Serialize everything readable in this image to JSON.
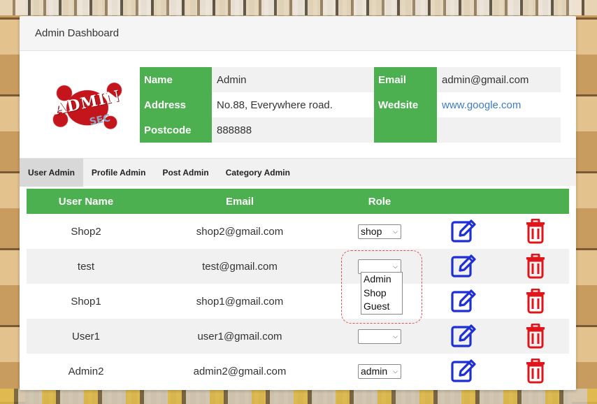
{
  "panel": {
    "title": "Admin Dashboard"
  },
  "logo": {
    "text": "ADMIN",
    "sub": "SEC"
  },
  "profile": {
    "name_label": "Name",
    "name_value": "Admin",
    "address_label": "Address",
    "address_value": "No.88, Everywhere road.",
    "postcode_label": "Postcode",
    "postcode_value": "888888",
    "email_label": "Email",
    "email_value": "admin@gmail.com",
    "website_label": "Wedsite",
    "website_value": "www.google.com"
  },
  "tabs": [
    {
      "label": "User Admin"
    },
    {
      "label": "Profile Admin"
    },
    {
      "label": "Post Admin"
    },
    {
      "label": "Category Admin"
    }
  ],
  "table": {
    "headers": {
      "user": "User Name",
      "email": "Email",
      "role": "Role"
    },
    "rows": [
      {
        "user": "Shop2",
        "email": "shop2@gmail.com",
        "role": "shop"
      },
      {
        "user": "test",
        "email": "test@gmail.com",
        "role": ""
      },
      {
        "user": "Shop1",
        "email": "shop1@gmail.com",
        "role": ""
      },
      {
        "user": "User1",
        "email": "user1@gmail.com",
        "role": ""
      },
      {
        "user": "Admin2",
        "email": "admin2@gmail.com",
        "role": "admin"
      }
    ]
  },
  "dropdown": {
    "options": [
      "Admin",
      "Shop",
      "Guest"
    ]
  },
  "colors": {
    "accent": "#4caf50",
    "edit": "#1f2fd6",
    "delete": "#e0151b",
    "link": "#3b7cc4"
  },
  "icons": {
    "edit": "edit-icon",
    "delete": "trash-icon"
  }
}
